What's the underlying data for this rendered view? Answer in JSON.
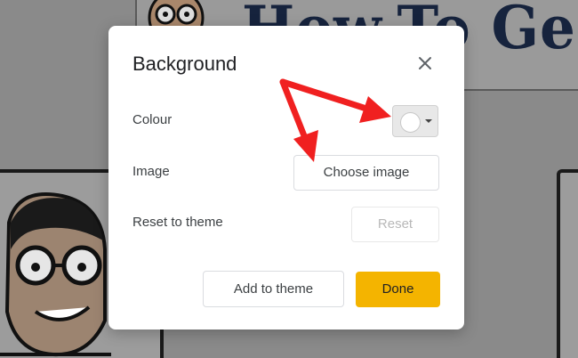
{
  "background": {
    "logo_text": "How-To Geek",
    "logo_mark": "®"
  },
  "dialog": {
    "title": "Background",
    "close_icon": "close-icon",
    "rows": {
      "colour": {
        "label": "Colour",
        "swatch_color": "#ffffff"
      },
      "image": {
        "label": "Image",
        "button": "Choose image"
      },
      "reset": {
        "label": "Reset to theme",
        "button": "Reset"
      }
    },
    "footer": {
      "add_to_theme": "Add to theme",
      "done": "Done"
    }
  },
  "colors": {
    "done_accent": "#f4b400",
    "annotation_arrow": "#f02020"
  }
}
